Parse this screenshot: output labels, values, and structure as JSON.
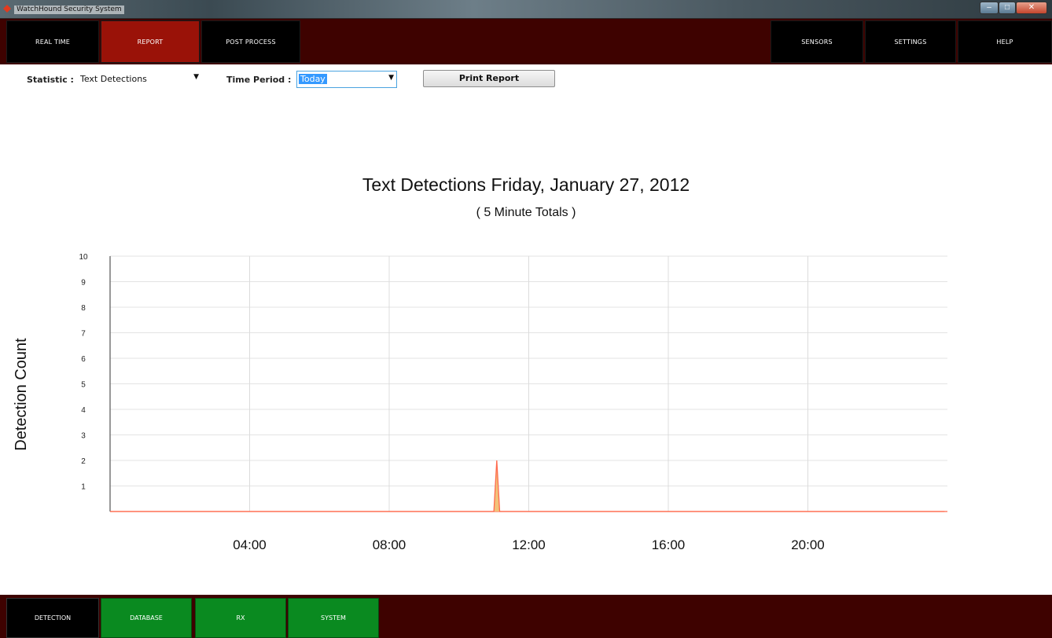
{
  "window": {
    "title": "WatchHound Security System"
  },
  "topnav": {
    "left": [
      {
        "label": "REAL TIME",
        "active": false
      },
      {
        "label": "REPORT",
        "active": true
      },
      {
        "label": "POST PROCESS",
        "active": false
      }
    ],
    "right": [
      {
        "label": "SENSORS"
      },
      {
        "label": "SETTINGS"
      },
      {
        "label": "HELP"
      }
    ]
  },
  "controls": {
    "statistic_label": "Statistic :",
    "statistic_value": "Text Detections",
    "period_label": "Time Period :",
    "period_value": "Today",
    "print_label": "Print Report"
  },
  "chart_data": {
    "type": "line",
    "title": "Text Detections Friday, January 27, 2012",
    "subtitle": "( 5 Minute Totals )",
    "ylabel": "Detection Count",
    "xlabel": "",
    "ylim": [
      0,
      10
    ],
    "xlim_hours": [
      0,
      24
    ],
    "yticks": [
      1,
      2,
      3,
      4,
      5,
      6,
      7,
      8,
      9,
      10
    ],
    "xticks": [
      "04:00",
      "08:00",
      "12:00",
      "16:00",
      "20:00"
    ],
    "grid": true,
    "series": [
      {
        "color": "#ff6a4d",
        "fill": "#f2c27a",
        "points": [
          {
            "time": "00:00",
            "value": 0
          },
          {
            "time": "11:00",
            "value": 0
          },
          {
            "time": "11:05",
            "value": 2
          },
          {
            "time": "11:10",
            "value": 0
          },
          {
            "time": "23:55",
            "value": 0
          }
        ]
      }
    ]
  },
  "bottomnav": [
    {
      "label": "DETECTION",
      "active": true
    },
    {
      "label": "DATABASE",
      "active": false
    },
    {
      "label": "RX",
      "active": false
    },
    {
      "label": "SYSTEM",
      "active": false
    }
  ]
}
